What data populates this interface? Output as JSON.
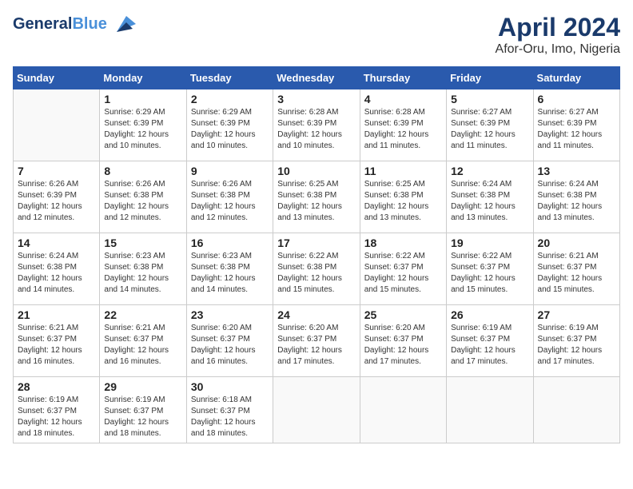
{
  "header": {
    "logo_line1": "General",
    "logo_line2": "Blue",
    "main_title": "April 2024",
    "subtitle": "Afor-Oru, Imo, Nigeria"
  },
  "days_of_week": [
    "Sunday",
    "Monday",
    "Tuesday",
    "Wednesday",
    "Thursday",
    "Friday",
    "Saturday"
  ],
  "weeks": [
    [
      {
        "day": "",
        "info": ""
      },
      {
        "day": "1",
        "info": "Sunrise: 6:29 AM\nSunset: 6:39 PM\nDaylight: 12 hours and 10 minutes."
      },
      {
        "day": "2",
        "info": "Sunrise: 6:29 AM\nSunset: 6:39 PM\nDaylight: 12 hours and 10 minutes."
      },
      {
        "day": "3",
        "info": "Sunrise: 6:28 AM\nSunset: 6:39 PM\nDaylight: 12 hours and 10 minutes."
      },
      {
        "day": "4",
        "info": "Sunrise: 6:28 AM\nSunset: 6:39 PM\nDaylight: 12 hours and 11 minutes."
      },
      {
        "day": "5",
        "info": "Sunrise: 6:27 AM\nSunset: 6:39 PM\nDaylight: 12 hours and 11 minutes."
      },
      {
        "day": "6",
        "info": "Sunrise: 6:27 AM\nSunset: 6:39 PM\nDaylight: 12 hours and 11 minutes."
      }
    ],
    [
      {
        "day": "7",
        "info": "Sunrise: 6:26 AM\nSunset: 6:39 PM\nDaylight: 12 hours and 12 minutes."
      },
      {
        "day": "8",
        "info": "Sunrise: 6:26 AM\nSunset: 6:38 PM\nDaylight: 12 hours and 12 minutes."
      },
      {
        "day": "9",
        "info": "Sunrise: 6:26 AM\nSunset: 6:38 PM\nDaylight: 12 hours and 12 minutes."
      },
      {
        "day": "10",
        "info": "Sunrise: 6:25 AM\nSunset: 6:38 PM\nDaylight: 12 hours and 13 minutes."
      },
      {
        "day": "11",
        "info": "Sunrise: 6:25 AM\nSunset: 6:38 PM\nDaylight: 12 hours and 13 minutes."
      },
      {
        "day": "12",
        "info": "Sunrise: 6:24 AM\nSunset: 6:38 PM\nDaylight: 12 hours and 13 minutes."
      },
      {
        "day": "13",
        "info": "Sunrise: 6:24 AM\nSunset: 6:38 PM\nDaylight: 12 hours and 13 minutes."
      }
    ],
    [
      {
        "day": "14",
        "info": "Sunrise: 6:24 AM\nSunset: 6:38 PM\nDaylight: 12 hours and 14 minutes."
      },
      {
        "day": "15",
        "info": "Sunrise: 6:23 AM\nSunset: 6:38 PM\nDaylight: 12 hours and 14 minutes."
      },
      {
        "day": "16",
        "info": "Sunrise: 6:23 AM\nSunset: 6:38 PM\nDaylight: 12 hours and 14 minutes."
      },
      {
        "day": "17",
        "info": "Sunrise: 6:22 AM\nSunset: 6:38 PM\nDaylight: 12 hours and 15 minutes."
      },
      {
        "day": "18",
        "info": "Sunrise: 6:22 AM\nSunset: 6:37 PM\nDaylight: 12 hours and 15 minutes."
      },
      {
        "day": "19",
        "info": "Sunrise: 6:22 AM\nSunset: 6:37 PM\nDaylight: 12 hours and 15 minutes."
      },
      {
        "day": "20",
        "info": "Sunrise: 6:21 AM\nSunset: 6:37 PM\nDaylight: 12 hours and 15 minutes."
      }
    ],
    [
      {
        "day": "21",
        "info": "Sunrise: 6:21 AM\nSunset: 6:37 PM\nDaylight: 12 hours and 16 minutes."
      },
      {
        "day": "22",
        "info": "Sunrise: 6:21 AM\nSunset: 6:37 PM\nDaylight: 12 hours and 16 minutes."
      },
      {
        "day": "23",
        "info": "Sunrise: 6:20 AM\nSunset: 6:37 PM\nDaylight: 12 hours and 16 minutes."
      },
      {
        "day": "24",
        "info": "Sunrise: 6:20 AM\nSunset: 6:37 PM\nDaylight: 12 hours and 17 minutes."
      },
      {
        "day": "25",
        "info": "Sunrise: 6:20 AM\nSunset: 6:37 PM\nDaylight: 12 hours and 17 minutes."
      },
      {
        "day": "26",
        "info": "Sunrise: 6:19 AM\nSunset: 6:37 PM\nDaylight: 12 hours and 17 minutes."
      },
      {
        "day": "27",
        "info": "Sunrise: 6:19 AM\nSunset: 6:37 PM\nDaylight: 12 hours and 17 minutes."
      }
    ],
    [
      {
        "day": "28",
        "info": "Sunrise: 6:19 AM\nSunset: 6:37 PM\nDaylight: 12 hours and 18 minutes."
      },
      {
        "day": "29",
        "info": "Sunrise: 6:19 AM\nSunset: 6:37 PM\nDaylight: 12 hours and 18 minutes."
      },
      {
        "day": "30",
        "info": "Sunrise: 6:18 AM\nSunset: 6:37 PM\nDaylight: 12 hours and 18 minutes."
      },
      {
        "day": "",
        "info": ""
      },
      {
        "day": "",
        "info": ""
      },
      {
        "day": "",
        "info": ""
      },
      {
        "day": "",
        "info": ""
      }
    ]
  ]
}
